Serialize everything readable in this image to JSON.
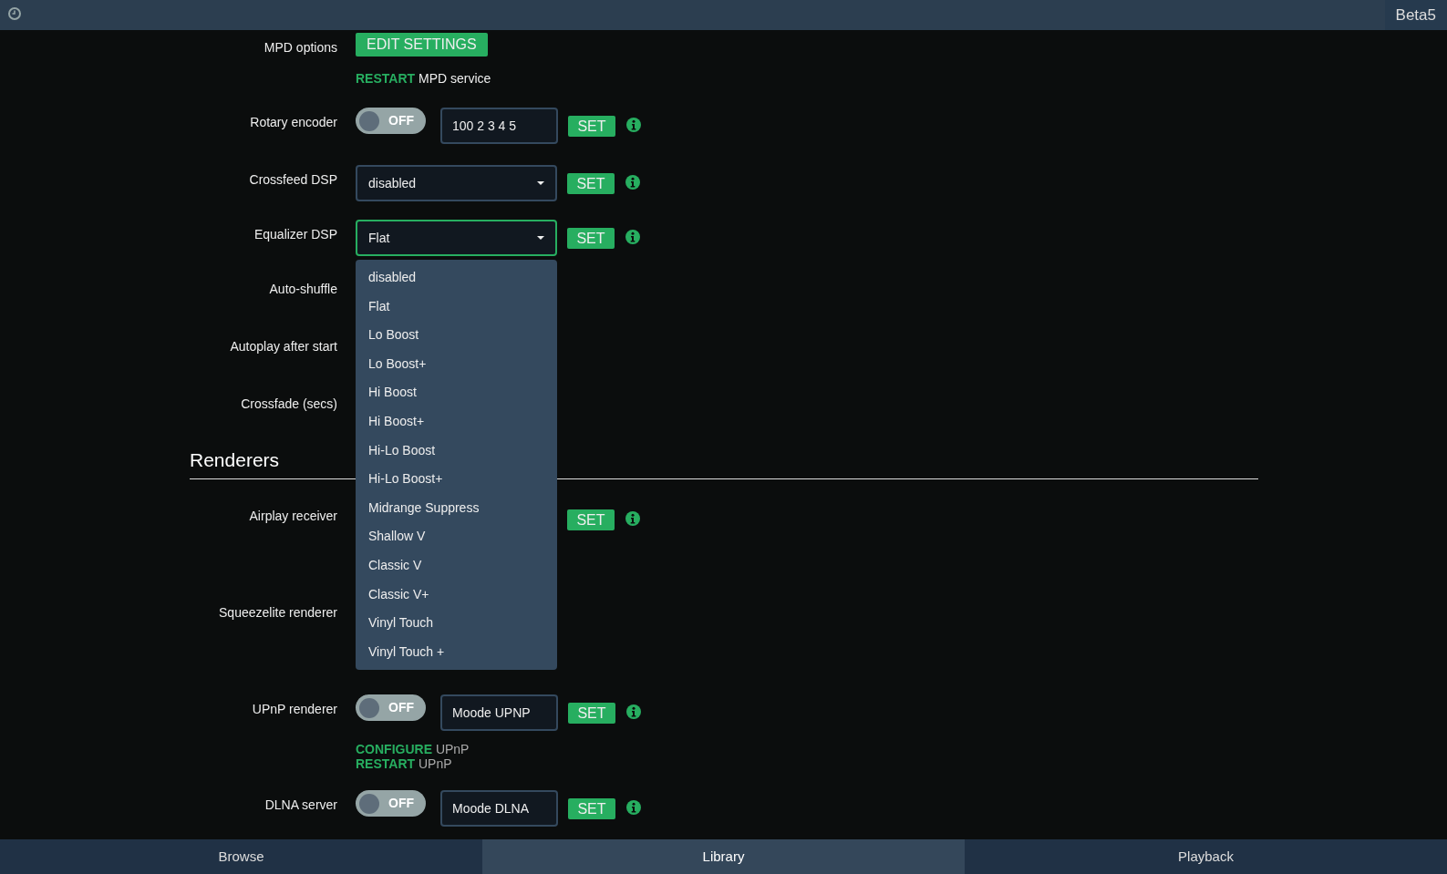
{
  "top_bar": {
    "version": "Beta5"
  },
  "rows": [
    {
      "kind": "button",
      "label": "MPD options",
      "button": "EDIT SETTINGS",
      "links": [
        {
          "action": "RESTART",
          "text": "MPD service"
        }
      ]
    },
    {
      "kind": "toggle-input",
      "label": "Rotary encoder",
      "on": false,
      "toggle_text": "OFF",
      "value": "100 2 3 4 5",
      "set": "SET"
    },
    {
      "kind": "select",
      "label": "Crossfeed DSP",
      "value": "disabled",
      "set": "SET",
      "focused": false
    },
    {
      "kind": "select",
      "label": "Equalizer DSP",
      "value": "Flat",
      "set": "SET",
      "focused": true,
      "options": [
        "disabled",
        "Flat",
        "Lo Boost",
        "Lo Boost+",
        "Hi Boost",
        "Hi Boost+",
        "Hi-Lo Boost",
        "Hi-Lo Boost+",
        "Midrange Suppress",
        "Shallow V",
        "Classic V",
        "Classic V+",
        "Vinyl Touch",
        "Vinyl Touch +"
      ]
    },
    {
      "kind": "covered",
      "label": "Auto-shuffle"
    },
    {
      "kind": "covered",
      "label": "Autoplay after start"
    },
    {
      "kind": "covered",
      "label": "Crossfade (secs)"
    }
  ],
  "renderers": {
    "title": "Renderers",
    "rows": [
      {
        "kind": "covered-set",
        "label": "Airplay receiver",
        "set": "SET"
      },
      {
        "kind": "covered",
        "label": "Squeezelite renderer"
      },
      {
        "kind": "toggle-input",
        "label": "UPnP renderer",
        "on": false,
        "toggle_text": "OFF",
        "value": "Moode UPNP",
        "set": "SET",
        "links": [
          {
            "action": "CONFIGURE",
            "text": "UPnP"
          },
          {
            "action": "RESTART",
            "text": "UPnP"
          }
        ]
      },
      {
        "kind": "toggle-input",
        "label": "DLNA server",
        "on": false,
        "toggle_text": "OFF",
        "value": "Moode DLNA",
        "set": "SET"
      }
    ]
  },
  "bottom_nav": [
    {
      "label": "Browse",
      "selected": false
    },
    {
      "label": "Library",
      "selected": true
    },
    {
      "label": "Playback",
      "selected": false
    }
  ]
}
